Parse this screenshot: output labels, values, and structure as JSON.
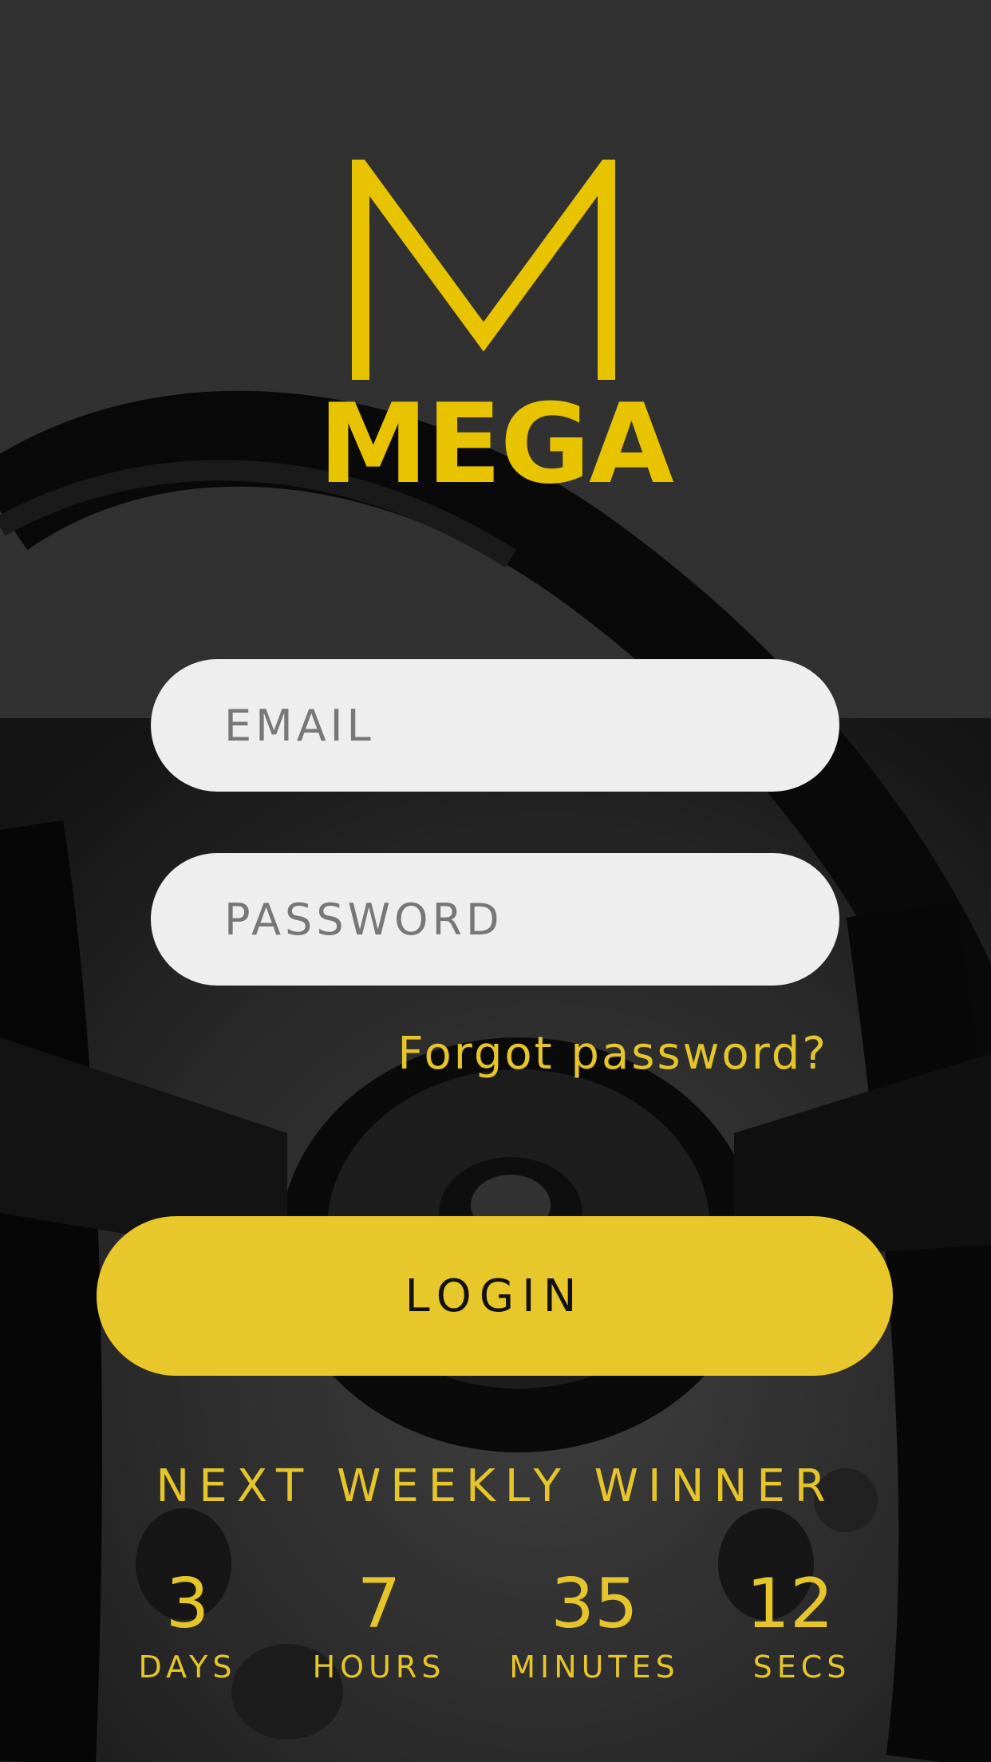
{
  "brand": {
    "name": "MEGA",
    "color": "#e8c300"
  },
  "form": {
    "email_placeholder": "EMAIL",
    "password_placeholder": "PASSWORD",
    "forgot_label": "Forgot password?",
    "login_label": "LOGIN"
  },
  "countdown": {
    "title": "NEXT WEEKLY WINNER",
    "days": {
      "value": "3",
      "label": "DAYS"
    },
    "hours": {
      "value": "7",
      "label": "HOURS"
    },
    "minutes": {
      "value": "35",
      "label": "MINUTES"
    },
    "secs": {
      "value": "12",
      "label": "SECS"
    }
  },
  "colors": {
    "accent": "#e8c72b",
    "field_bg": "#eeeeee",
    "background": "#383838"
  },
  "background_image": "steering-wheel-photo"
}
